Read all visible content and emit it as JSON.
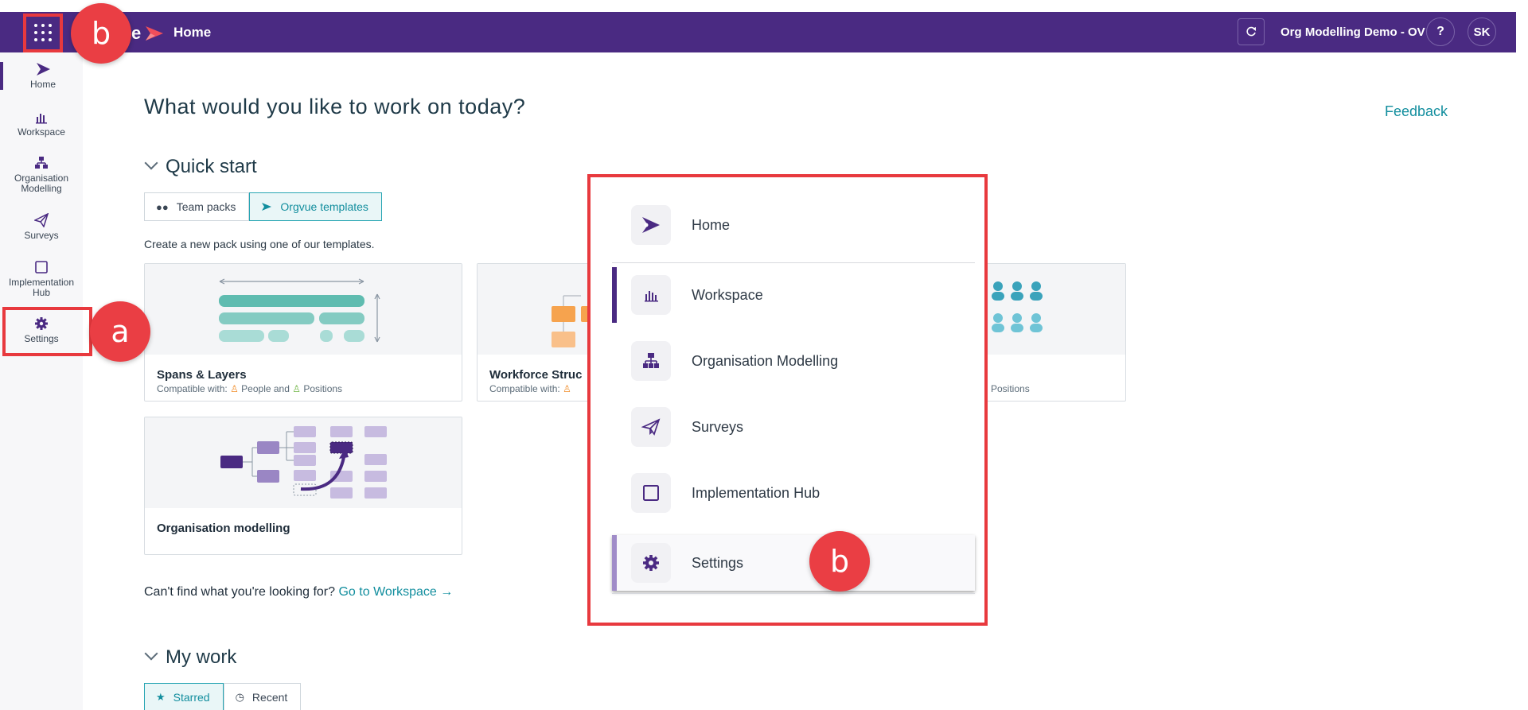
{
  "topbar": {
    "title": "Home",
    "logo_letter": "e",
    "org_name": "Org Modelling Demo - OV",
    "help": "?",
    "avatar": "SK"
  },
  "sidebar": {
    "items": [
      {
        "label": "Home",
        "icon": "home-logo-icon"
      },
      {
        "label": "Workspace",
        "icon": "bar-chart-icon"
      },
      {
        "label": "Organisation Modelling",
        "icon": "org-chart-icon"
      },
      {
        "label": "Surveys",
        "icon": "paper-plane-icon"
      },
      {
        "label": "Implementation Hub",
        "icon": "square-icon"
      },
      {
        "label": "Settings",
        "icon": "gear-icon"
      }
    ]
  },
  "main": {
    "heading": "What would you like to work on today?",
    "feedback": "Feedback",
    "quick_start": {
      "heading": "Quick start",
      "tabs": [
        "Team packs",
        "Orgvue templates"
      ],
      "hint": "Create a new pack using one of our templates.",
      "cards": [
        {
          "title": "Spans & Layers",
          "compat_prefix": "Compatible with:",
          "people": "People and",
          "positions": "Positions"
        },
        {
          "title": "Workforce Struc",
          "compat_prefix": "Compatible with:"
        },
        {
          "positions": "Positions"
        },
        {
          "title": "Organisation modelling"
        }
      ]
    },
    "footer_question": "Can't find what you're looking for?",
    "footer_link": "Go to Workspace →",
    "my_work": {
      "heading": "My work",
      "tabs": [
        "Starred",
        "Recent"
      ]
    }
  },
  "popup": {
    "items": [
      {
        "label": "Home",
        "icon": "home-logo-icon"
      },
      {
        "label": "Workspace",
        "icon": "bar-chart-icon"
      },
      {
        "label": "Organisation Modelling",
        "icon": "org-chart-icon"
      },
      {
        "label": "Surveys",
        "icon": "paper-plane-icon"
      },
      {
        "label": "Implementation Hub",
        "icon": "square-icon"
      },
      {
        "label": "Settings",
        "icon": "gear-icon"
      }
    ]
  },
  "annotations": {
    "a": "a",
    "b": "b"
  },
  "colors": {
    "brand": "#4a2a82",
    "accent": "#128e9e",
    "callout": "#ea3e44"
  }
}
